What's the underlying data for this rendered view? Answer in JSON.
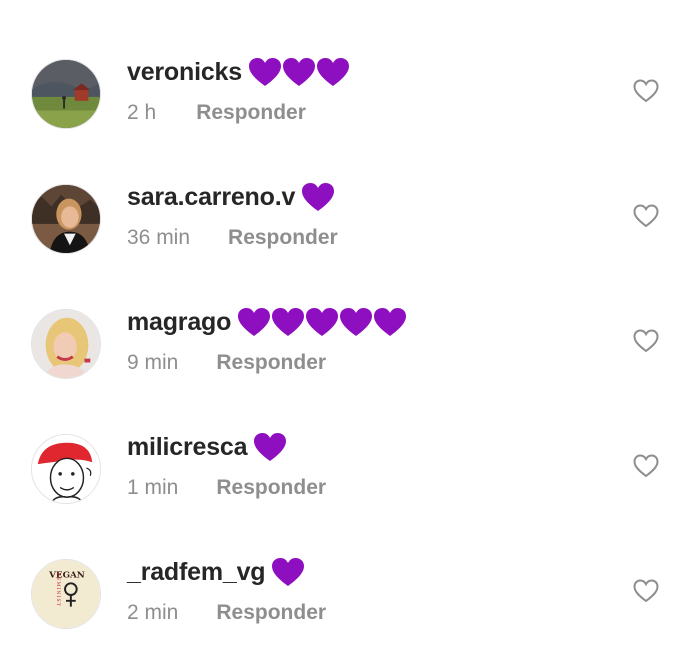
{
  "comments": [
    {
      "username": "veronicks",
      "heart_count": 3,
      "time": "2 h",
      "reply_label": "Responder"
    },
    {
      "username": "sara.carreno.v",
      "heart_count": 1,
      "time": "36 min",
      "reply_label": "Responder"
    },
    {
      "username": "magrago",
      "heart_count": 5,
      "time": "9 min",
      "reply_label": "Responder"
    },
    {
      "username": "milicresca",
      "heart_count": 1,
      "time": "1 min",
      "reply_label": "Responder"
    },
    {
      "username": "_radfem_vg",
      "heart_count": 1,
      "time": "2 min",
      "reply_label": "Responder"
    }
  ],
  "avatar_5_text": {
    "top": "VEGAN",
    "side": "FEMINIST",
    "symbol": "♀"
  },
  "colors": {
    "heart_emoji": "#8e0fbf",
    "username": "#262626",
    "meta": "#8e8e8e",
    "like_outline": "#8e8e8e"
  },
  "icons": {
    "emoji": "purple-heart-icon",
    "like": "heart-outline-icon"
  }
}
